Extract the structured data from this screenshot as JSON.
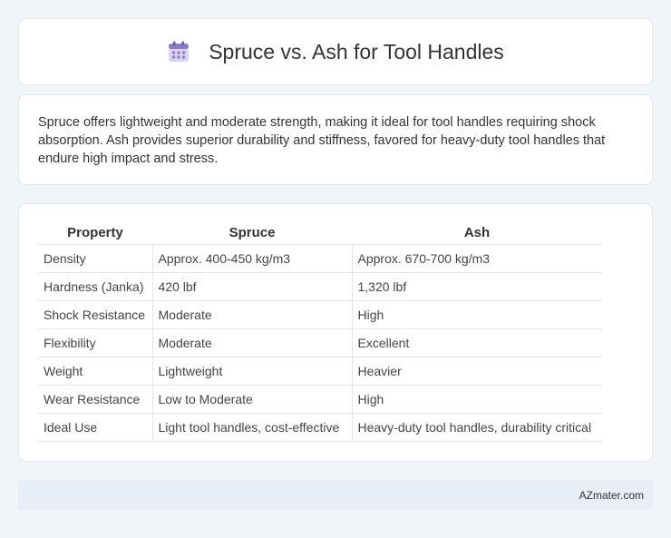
{
  "header": {
    "title": "Spruce vs. Ash for Tool Handles",
    "icon": "calendar-icon"
  },
  "description": "Spruce offers lightweight and moderate strength, making it ideal for tool handles requiring shock absorption. Ash provides superior durability and stiffness, favored for heavy-duty tool handles that endure high impact and stress.",
  "table": {
    "headers": [
      "Property",
      "Spruce",
      "Ash"
    ],
    "rows": [
      [
        "Density",
        "Approx. 400-450 kg/m3",
        "Approx. 670-700 kg/m3"
      ],
      [
        "Hardness (Janka)",
        "420 lbf",
        "1,320 lbf"
      ],
      [
        "Shock Resistance",
        "Moderate",
        "High"
      ],
      [
        "Flexibility",
        "Moderate",
        "Excellent"
      ],
      [
        "Weight",
        "Lightweight",
        "Heavier"
      ],
      [
        "Wear Resistance",
        "Low to Moderate",
        "High"
      ],
      [
        "Ideal Use",
        "Light tool handles, cost-effective",
        "Heavy-duty tool handles, durability critical"
      ]
    ]
  },
  "footer": {
    "site": "AZmater.com"
  },
  "colors": {
    "background": "#f1f4f9",
    "card": "#ffffff",
    "footer": "#e8eef8",
    "icon_accent": "#8e7cc3"
  }
}
